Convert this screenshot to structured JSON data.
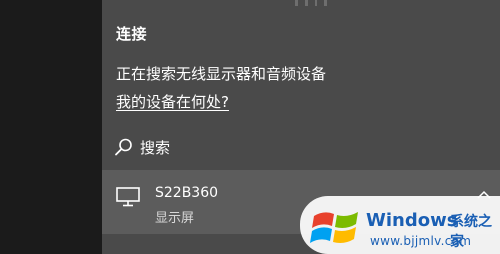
{
  "panel": {
    "title": "连接",
    "status_text": "正在搜索无线显示器和音频设备",
    "help_link": "我的设备在何处?",
    "search_label": "搜索",
    "search_icon": "search-icon"
  },
  "device": {
    "name": "S22B360",
    "type": "显示屏",
    "icon": "monitor-icon"
  },
  "watermark": {
    "brand": "Windows",
    "brand_suffix": "系统之家",
    "url": "www.bjjmlv.com"
  },
  "colors": {
    "panel_bg": "#4a4a4a",
    "device_row_bg": "#5c5c5c",
    "left_strip_bg": "#1b1b1b",
    "watermark_text": "#1a5fb4"
  }
}
